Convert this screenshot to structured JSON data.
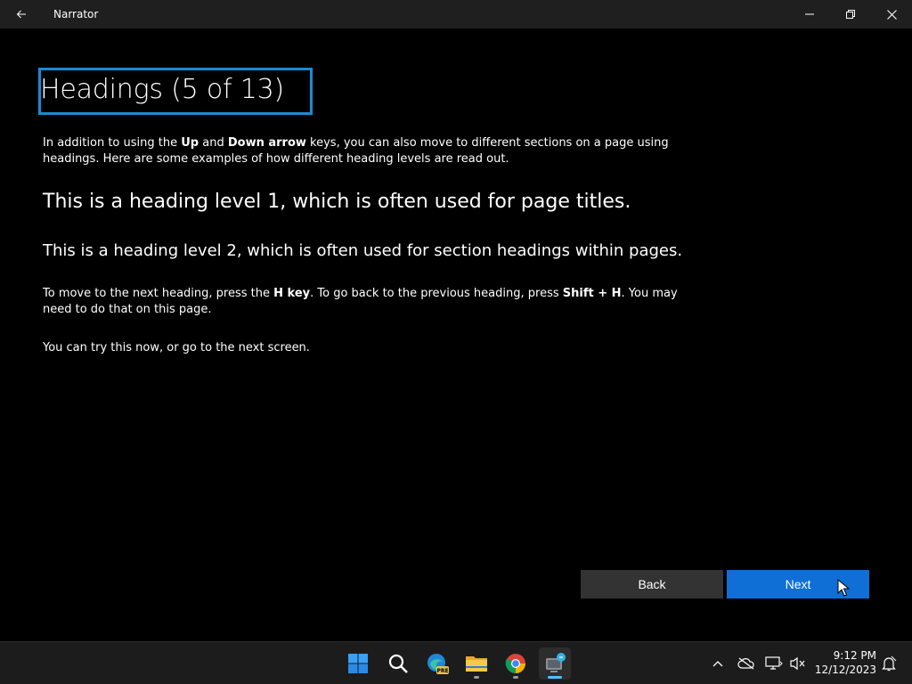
{
  "window": {
    "title": "Narrator"
  },
  "content": {
    "heading": "Headings (5 of 13)",
    "intro": {
      "t1": "In addition to using the ",
      "b1": "Up",
      "t2": " and ",
      "b2": "Down arrow",
      "t3": " keys, you can also move to different sections on a page using headings. Here are some examples of how different heading levels are read out."
    },
    "heading1_example": "This is a heading level 1, which is often used for page titles.",
    "heading2_example": "This is a heading level 2, which is often used for section headings within pages.",
    "instruction": {
      "t1": "To move to the next heading, press the ",
      "b1": "H key",
      "t2": ". To go back to the previous heading, press ",
      "b2": "Shift + H",
      "t3": ". You may need to do that on this page."
    },
    "try_now": "You can try this now, or go to the next screen."
  },
  "buttons": {
    "back": "Back",
    "next": "Next"
  },
  "taskbar": {
    "apps": [
      "start-icon",
      "search-icon",
      "edge-preview-icon",
      "file-explorer-icon",
      "chrome-icon",
      "narrator-icon"
    ],
    "clock": {
      "time": "9:12 PM",
      "date": "12/12/2023"
    }
  },
  "colors": {
    "accent": "#0f6fd6",
    "focus": "#1a8ad4",
    "back_button": "#333333"
  }
}
